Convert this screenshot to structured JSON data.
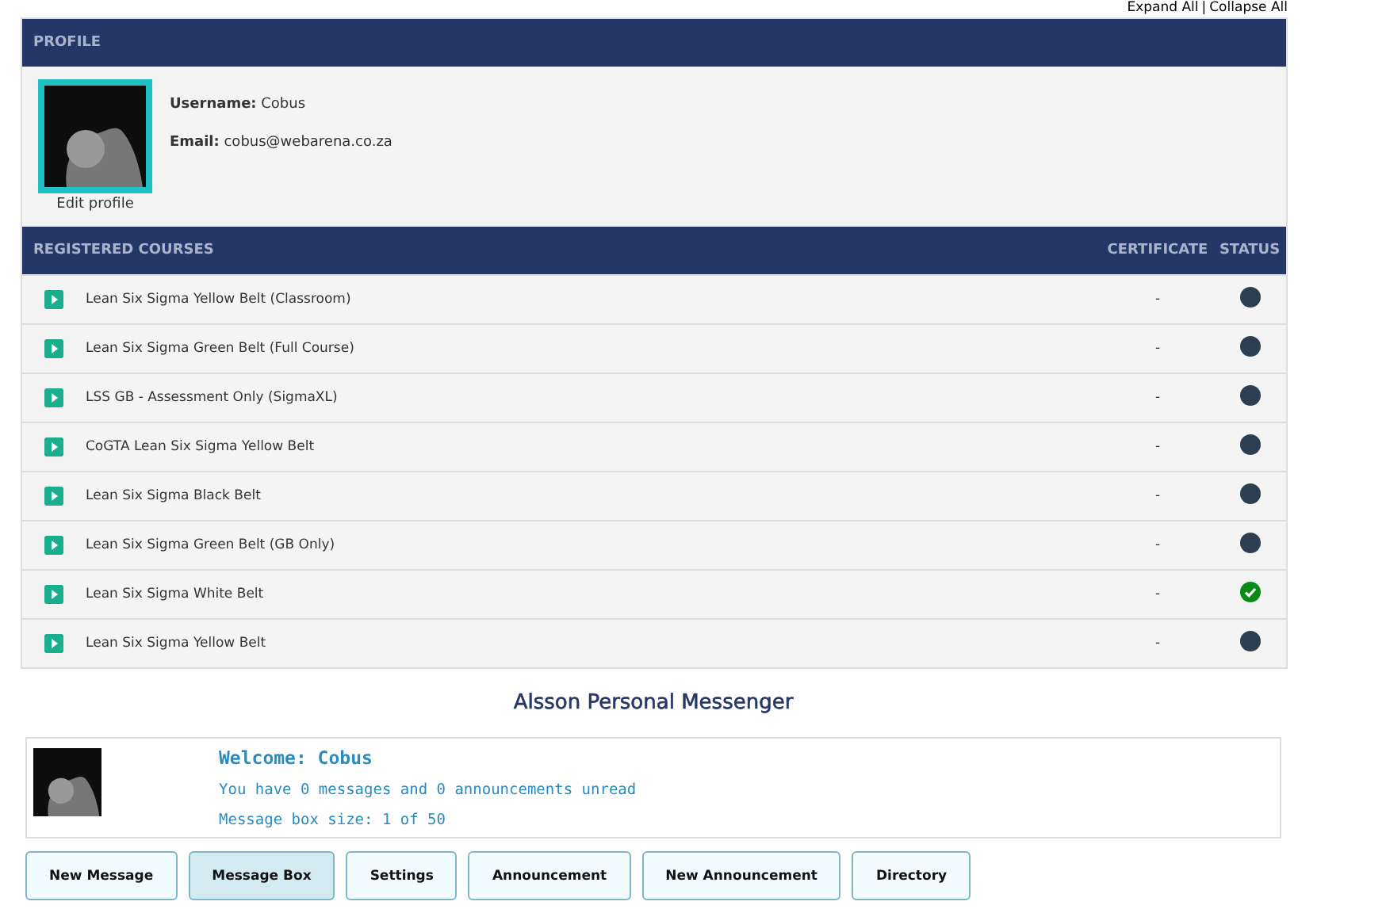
{
  "top_links": {
    "expand": "Expand All",
    "separator": "|",
    "collapse": "Collapse All"
  },
  "profile": {
    "title": "PROFILE",
    "edit_label": "Edit profile",
    "fields": [
      {
        "label": "Username:",
        "value": "Cobus"
      },
      {
        "label": "Email:",
        "value": "cobus@webarena.co.za"
      }
    ]
  },
  "courses": {
    "title": "REGISTERED COURSES",
    "columns": [
      "CERTIFICATE",
      "STATUS"
    ],
    "rows": [
      {
        "name": "Lean Six Sigma Yellow Belt (Classroom)",
        "certificate": "-",
        "completed": false
      },
      {
        "name": "Lean Six Sigma Green Belt (Full Course)",
        "certificate": "-",
        "completed": false
      },
      {
        "name": "LSS GB - Assessment Only (SigmaXL)",
        "certificate": "-",
        "completed": false
      },
      {
        "name": "CoGTA Lean Six Sigma Yellow Belt",
        "certificate": "-",
        "completed": false
      },
      {
        "name": "Lean Six Sigma Black Belt",
        "certificate": "-",
        "completed": false
      },
      {
        "name": "Lean Six Sigma Green Belt (GB Only)",
        "certificate": "-",
        "completed": false
      },
      {
        "name": "Lean Six Sigma White Belt",
        "certificate": "-",
        "completed": true
      },
      {
        "name": "Lean Six Sigma Yellow Belt",
        "certificate": "-",
        "completed": false
      }
    ]
  },
  "messenger": {
    "title": "Alsson Personal Messenger",
    "welcome": "Welcome: Cobus",
    "unread": "You have 0 messages and 0 announcements unread",
    "box_size": "Message box size: 1 of 50",
    "buttons": [
      {
        "label": "New Message",
        "selected": false
      },
      {
        "label": "Message Box",
        "selected": true
      },
      {
        "label": "Settings",
        "selected": false
      },
      {
        "label": "Announcement",
        "selected": false
      },
      {
        "label": "New Announcement",
        "selected": false
      },
      {
        "label": "Directory",
        "selected": false
      }
    ]
  }
}
